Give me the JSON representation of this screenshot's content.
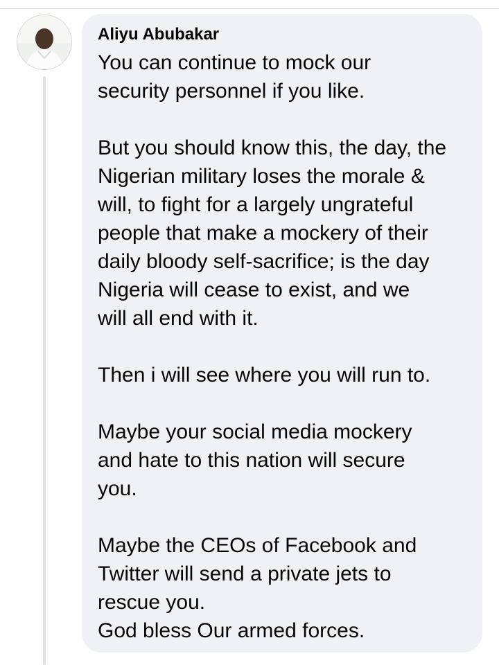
{
  "comment": {
    "author": "Aliyu Abubakar",
    "lines": [
      "You can continue to mock our",
      "security personnel if you like.",
      "But you should know this, the day, the",
      "Nigerian military loses the morale &",
      "will, to fight for a largely ungrateful",
      "people that make a mockery of their",
      "daily bloody self-sacrifice; is the day",
      "Nigeria will cease to exist, and we",
      "will all end with it.",
      "Then i will see where you will run to.",
      "Maybe your social media mockery",
      "and hate to this nation will secure",
      "you.",
      "Maybe the CEOs of Facebook and",
      "Twitter will send a private jets to",
      "rescue you.",
      "God bless Our armed forces."
    ],
    "reactions": [
      "like-icon",
      "haha-icon",
      "wow-icon"
    ]
  }
}
